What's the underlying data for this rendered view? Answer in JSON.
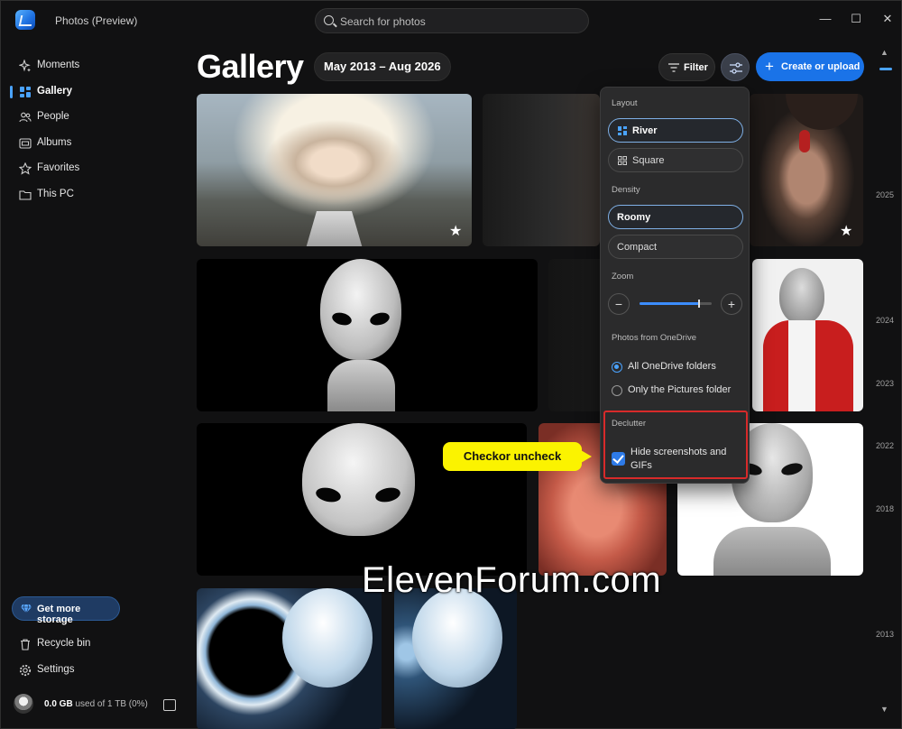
{
  "window": {
    "app_title": "Photos (Preview)",
    "search_placeholder": "Search for photos",
    "minimize_glyph": "—",
    "maximize_glyph": "☐",
    "close_glyph": "✕"
  },
  "sidebar": {
    "items": [
      {
        "label": "Moments",
        "icon": "sparkle-icon"
      },
      {
        "label": "Gallery",
        "icon": "gallery-grid-icon",
        "active": true
      },
      {
        "label": "People",
        "icon": "people-icon"
      },
      {
        "label": "Albums",
        "icon": "album-icon"
      },
      {
        "label": "Favorites",
        "icon": "star-icon"
      },
      {
        "label": "This PC",
        "icon": "folder-icon"
      }
    ],
    "storage_button": "Get more storage",
    "bottom_items": [
      {
        "label": "Recycle bin",
        "icon": "trash-icon"
      },
      {
        "label": "Settings",
        "icon": "gear-icon"
      }
    ],
    "storage_amount": "0.0 GB",
    "storage_rest": " used of 1 TB (0%)"
  },
  "header": {
    "title": "Gallery",
    "date_range": "May 2013 – Aug 2026",
    "filter_label": "Filter",
    "create_label": "Create or upload",
    "create_glyph": "+"
  },
  "view_panel": {
    "layout_label": "Layout",
    "layout_options": [
      "River",
      "Square"
    ],
    "layout_selected": "River",
    "density_label": "Density",
    "density_options": [
      "Roomy",
      "Compact"
    ],
    "density_selected": "Roomy",
    "zoom_label": "Zoom",
    "zoom_level": 0.82,
    "onedrive_label": "Photos from OneDrive",
    "onedrive_options": [
      "All OneDrive folders",
      "Only the Pictures folder"
    ],
    "onedrive_selected": "All OneDrive folders",
    "declutter_label": "Declutter",
    "declutter_checkbox_label": "Hide screenshots and GIFs",
    "declutter_checked": true
  },
  "timeline": {
    "years": [
      "2025",
      "2024",
      "2023",
      "2022",
      "2018",
      "2013"
    ]
  },
  "callout": {
    "text": "Checkor uncheck"
  },
  "watermark": {
    "text": "ElevenForum.com"
  },
  "colors": {
    "accent": "#1a73e8",
    "callout": "#fbf300",
    "highlight_border": "#d82a2a"
  }
}
